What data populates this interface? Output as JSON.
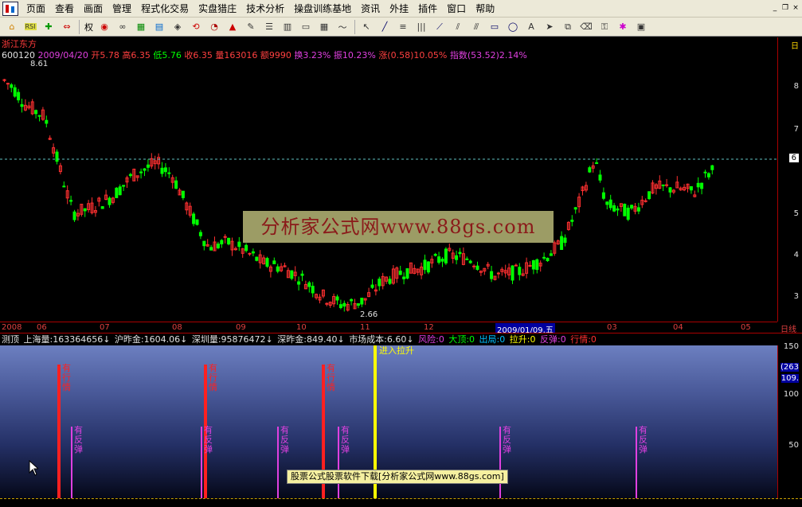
{
  "menu": {
    "items": [
      "页面",
      "查看",
      "画面",
      "管理",
      "程式化交易",
      "实盘猎庄",
      "技术分析",
      "操盘训练基地",
      "资讯",
      "外挂",
      "插件",
      "窗口",
      "帮助"
    ]
  },
  "toolbar": {
    "rights_label": "权",
    "rsi_label": "RSI",
    "icons": [
      "home-icon",
      "rsi-icon",
      "move-icon",
      "arrows-icon",
      "rights-icon",
      "circle-icon",
      "glasses-icon",
      "stocks-icon",
      "chart-icon",
      "cube-icon",
      "ticker-icon",
      "bell-icon",
      "pen-icon",
      "grid-icon",
      "layout-icon",
      "window-icon",
      "table-icon",
      "line-chart-icon",
      "cursor-icon",
      "line-tool-icon",
      "level-icon",
      "vertical-lines-icon",
      "fan-icon",
      "parallel-icon",
      "channel-icon",
      "rect-icon",
      "ellipse-icon",
      "text-icon",
      "arrow-icon",
      "copy-icon",
      "eraser-icon",
      "lock-icon",
      "color-icon",
      "save-icon"
    ]
  },
  "stock": {
    "name": "浙江东方",
    "code": "600120",
    "date": "2009/04/20",
    "open": "开5.78",
    "high": "高6.35",
    "low": "低5.76",
    "close": "收6.35",
    "volume": "量163016",
    "amount": "额9990",
    "turnover": "换3.23%",
    "amplitude": "振10.23%",
    "change": "涨(0.58)10.05%",
    "index": "指数(53.52)2.14%",
    "high_mark": "8.61",
    "low_mark": "2.66"
  },
  "watermark": "分析家公式网www.88gs.com",
  "price_axis": {
    "labels": [
      "8",
      "7",
      "6",
      "5",
      "4",
      "3"
    ],
    "current": "6",
    "top_label": "日"
  },
  "date_axis": {
    "labels": [
      "2008",
      "06",
      "07",
      "08",
      "09",
      "10",
      "11",
      "12",
      "2009/01/09,五",
      "03",
      "04",
      "05"
    ],
    "right_label": "日线"
  },
  "indicator_bar": {
    "name": "测顶",
    "items": [
      {
        "text": "上海量:163364656↓",
        "color": "#e0e0e0"
      },
      {
        "text": "沪昨金:1604.06↓",
        "color": "#e0e0e0"
      },
      {
        "text": "深圳量:95876472↓",
        "color": "#e0e0e0"
      },
      {
        "text": "深昨金:849.40↓",
        "color": "#e0e0e0"
      },
      {
        "text": "市场成本:6.60↓",
        "color": "#e0e0e0"
      },
      {
        "text": "风险:0",
        "color": "#e040e0"
      },
      {
        "text": "大顶:0",
        "color": "#00ff00"
      },
      {
        "text": "出局:0",
        "color": "#00c0ff"
      },
      {
        "text": "拉升:0",
        "color": "#ffff00"
      },
      {
        "text": "反弹:0",
        "color": "#e040e0"
      },
      {
        "text": "行情:0",
        "color": "#ff3030"
      }
    ]
  },
  "lower_panel": {
    "entry_label": "进入拉升",
    "signal_top": "有行情",
    "signal_rebound": "有反弹",
    "axis": [
      "150",
      "100",
      "50"
    ],
    "axis_box_1": "(263",
    "axis_box_2": "109."
  },
  "tip": "股票公式股票软件下载[分析家公式网www.88gs.com]",
  "colors": {
    "up": "#ff3030",
    "down": "#00ff00",
    "accent": "#e040e0",
    "signal_yellow": "#ffff00"
  }
}
